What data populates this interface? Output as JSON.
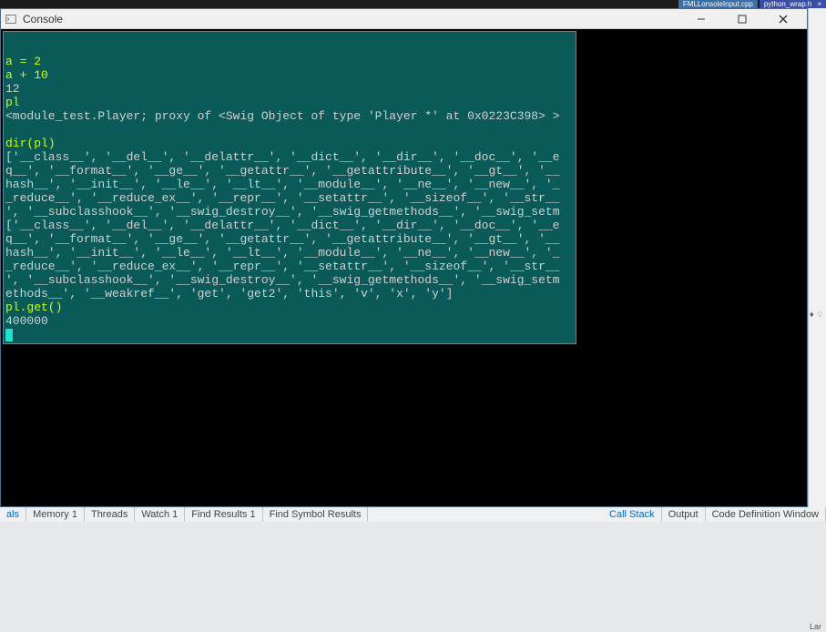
{
  "topTabs": [
    {
      "label": "FMLLonsoleInput.cpp"
    },
    {
      "label": "python_wrap.h"
    }
  ],
  "window": {
    "title": "Console"
  },
  "console": {
    "lines": [
      {
        "type": "blank",
        "text": ""
      },
      {
        "type": "input",
        "text": "a = 2"
      },
      {
        "type": "input",
        "text": "a + 10"
      },
      {
        "type": "output",
        "text": "12"
      },
      {
        "type": "input",
        "text": "pl"
      },
      {
        "type": "output",
        "text": "<module_test.Player; proxy of <Swig Object of type 'Player *' at 0x0223C398> >"
      },
      {
        "type": "blank",
        "text": ""
      },
      {
        "type": "input",
        "text": "dir(pl)"
      },
      {
        "type": "output",
        "text": "['__class__', '__del__', '__delattr__', '__dict__', '__dir__', '__doc__', '__e"
      },
      {
        "type": "output",
        "text": "q__', '__format__', '__ge__', '__getattr__', '__getattribute__', '__gt__', '__"
      },
      {
        "type": "output",
        "text": "hash__', '__init__', '__le__', '__lt__', '__module__', '__ne__', '__new__', '_"
      },
      {
        "type": "output",
        "text": "_reduce__', '__reduce_ex__', '__repr__', '__setattr__', '__sizeof__', '__str__"
      },
      {
        "type": "output",
        "text": "', '__subclasshook__', '__swig_destroy__', '__swig_getmethods__', '__swig_setm"
      },
      {
        "type": "output",
        "text": "['__class__', '__del__', '__delattr__', '__dict__', '__dir__', '__doc__', '__e"
      },
      {
        "type": "output",
        "text": "q__', '__format__', '__ge__', '__getattr__', '__getattribute__', '__gt__', '__"
      },
      {
        "type": "output",
        "text": "hash__', '__init__', '__le__', '__lt__', '__module__', '__ne__', '__new__', '_"
      },
      {
        "type": "output",
        "text": "_reduce__', '__reduce_ex__', '__repr__', '__setattr__', '__sizeof__', '__str__"
      },
      {
        "type": "output",
        "text": "', '__subclasshook__', '__swig_destroy__', '__swig_getmethods__', '__swig_setm"
      },
      {
        "type": "output",
        "text": "ethods__', '__weakref__', 'get', 'get2', 'this', 'v', 'x', 'y']"
      },
      {
        "type": "input",
        "text": "pl.get()"
      },
      {
        "type": "output",
        "text": "400000"
      }
    ]
  },
  "rightStrip": {
    "l1": "♦ ♢",
    "l2": "Lar"
  },
  "bottomTabs": {
    "left": [
      "als",
      "Memory 1",
      "Threads",
      "Watch 1",
      "Find Results 1",
      "Find Symbol Results"
    ],
    "right": [
      "Call Stack",
      "Output",
      "Code Definition Window"
    ]
  }
}
